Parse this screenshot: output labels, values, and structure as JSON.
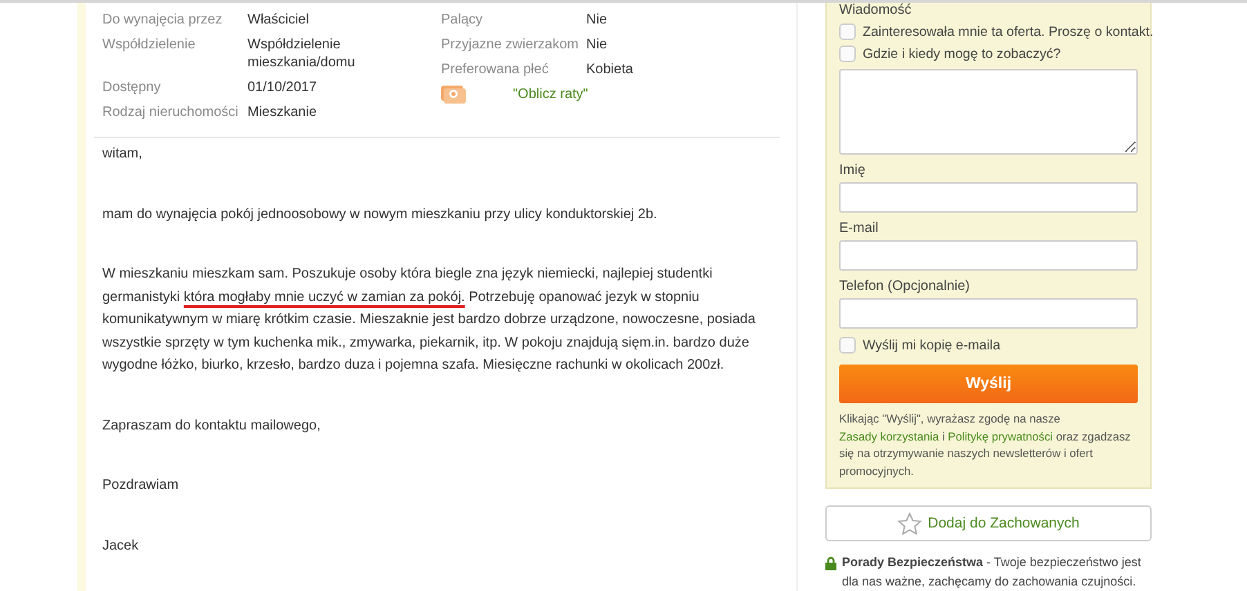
{
  "details_left": [
    {
      "label": "Do wynajęcia przez",
      "value": "Właściciel"
    },
    {
      "label": "Współdzielenie",
      "value": "Współdzielenie mieszkania/domu"
    },
    {
      "label": "Dostępny",
      "value": "01/10/2017"
    },
    {
      "label": "Rodzaj nieruchomości",
      "value": "Mieszkanie"
    }
  ],
  "details_right": [
    {
      "label": "Palący",
      "value": "Nie"
    },
    {
      "label": "Przyjazne zwierzakom",
      "value": "Nie"
    },
    {
      "label": "Preferowana płeć",
      "value": "Kobieta"
    }
  ],
  "installments_link": "\"Oblicz raty\"",
  "description": [
    {
      "segments": [
        {
          "kind": "plain",
          "text": "witam,"
        }
      ]
    },
    {
      "segments": [
        {
          "kind": "plain",
          "text": "mam do wynajęcia pokój jednoosobowy w nowym mieszkaniu przy ulicy konduktorskiej 2b."
        }
      ]
    },
    {
      "segments": [
        {
          "kind": "plain",
          "text": "W mieszkaniu mieszkam sam. Poszukuje osoby która biegle zna język niemiecki, najlepiej studentki germanistyki "
        },
        {
          "kind": "underlined",
          "text": "która mogłaby mnie uczyć w zamian za pokój."
        },
        {
          "kind": "plain",
          "text": " Potrzebuję opanować jezyk w stopniu komunikatywnym w miarę krótkim czasie. Mieszaknie jest bardzo dobrze urządzone, nowoczesne, posiada wszystkie sprzęty w tym kuchenka mik., zmywarka, piekarnik, itp. W pokoju znajdują sięm.in. bardzo duże wygodne łóżko, biurko, krzesło, bardzo duza i pojemna szafa. Miesięczne rachunki w okolicach 200zł."
        }
      ]
    },
    {
      "segments": [
        {
          "kind": "plain",
          "text": "Zapraszam do kontaktu mailowego,"
        }
      ]
    },
    {
      "segments": [
        {
          "kind": "plain",
          "text": "Pozdrawiam"
        }
      ]
    },
    {
      "segments": [
        {
          "kind": "plain",
          "text": "Jacek"
        }
      ]
    }
  ],
  "form": {
    "message_label": "Wiadomość",
    "quick_options": [
      {
        "label": "Zainteresowała mnie ta oferta. Proszę o kontakt.",
        "checked": false
      },
      {
        "label": "Gdzie i kiedy mogę to zobaczyć?",
        "checked": false
      }
    ],
    "fields": [
      {
        "label": "Imię"
      },
      {
        "label": "E-mail"
      },
      {
        "label": "Telefon (Opcjonalnie)"
      }
    ],
    "copy_option": {
      "label": "Wyślij mi kopię e-maila",
      "checked": false
    },
    "submit": "Wyślij",
    "consent": "Klikając \"Wyślij\", wyrażasz zgodę na nasze ",
    "terms_link": "Zasady korzystania",
    "consent_and": " i ",
    "privacy_link": "Politykę prywatności",
    "consent_end": " oraz zgadzasz się na otrzymywanie naszych newsletterów i ofert promocyjnych."
  },
  "save_button": "Dodaj do Zachowanych",
  "safety": {
    "title": "Porady Bezpieczeństwa",
    "text": " - Twoje bezpieczeństwo jest dla nas ważne, zachęcamy do zachowania czujności."
  }
}
